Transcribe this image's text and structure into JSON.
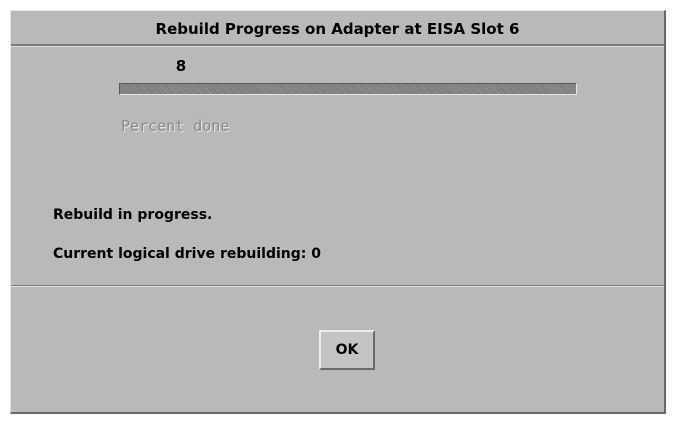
{
  "dialog": {
    "title": "Rebuild Progress on Adapter at EISA Slot 6"
  },
  "progress": {
    "value_label": "8",
    "percent": 100,
    "caption": "Percent done"
  },
  "status": {
    "message": "Rebuild in progress.",
    "current_drive": "Current logical drive rebuilding:  0"
  },
  "buttons": {
    "ok_label": "OK"
  },
  "colors": {
    "dialog_bg": "#b9b9b9",
    "progress_fill": "#8f8f8f",
    "caption_text": "#8a8a8a"
  }
}
